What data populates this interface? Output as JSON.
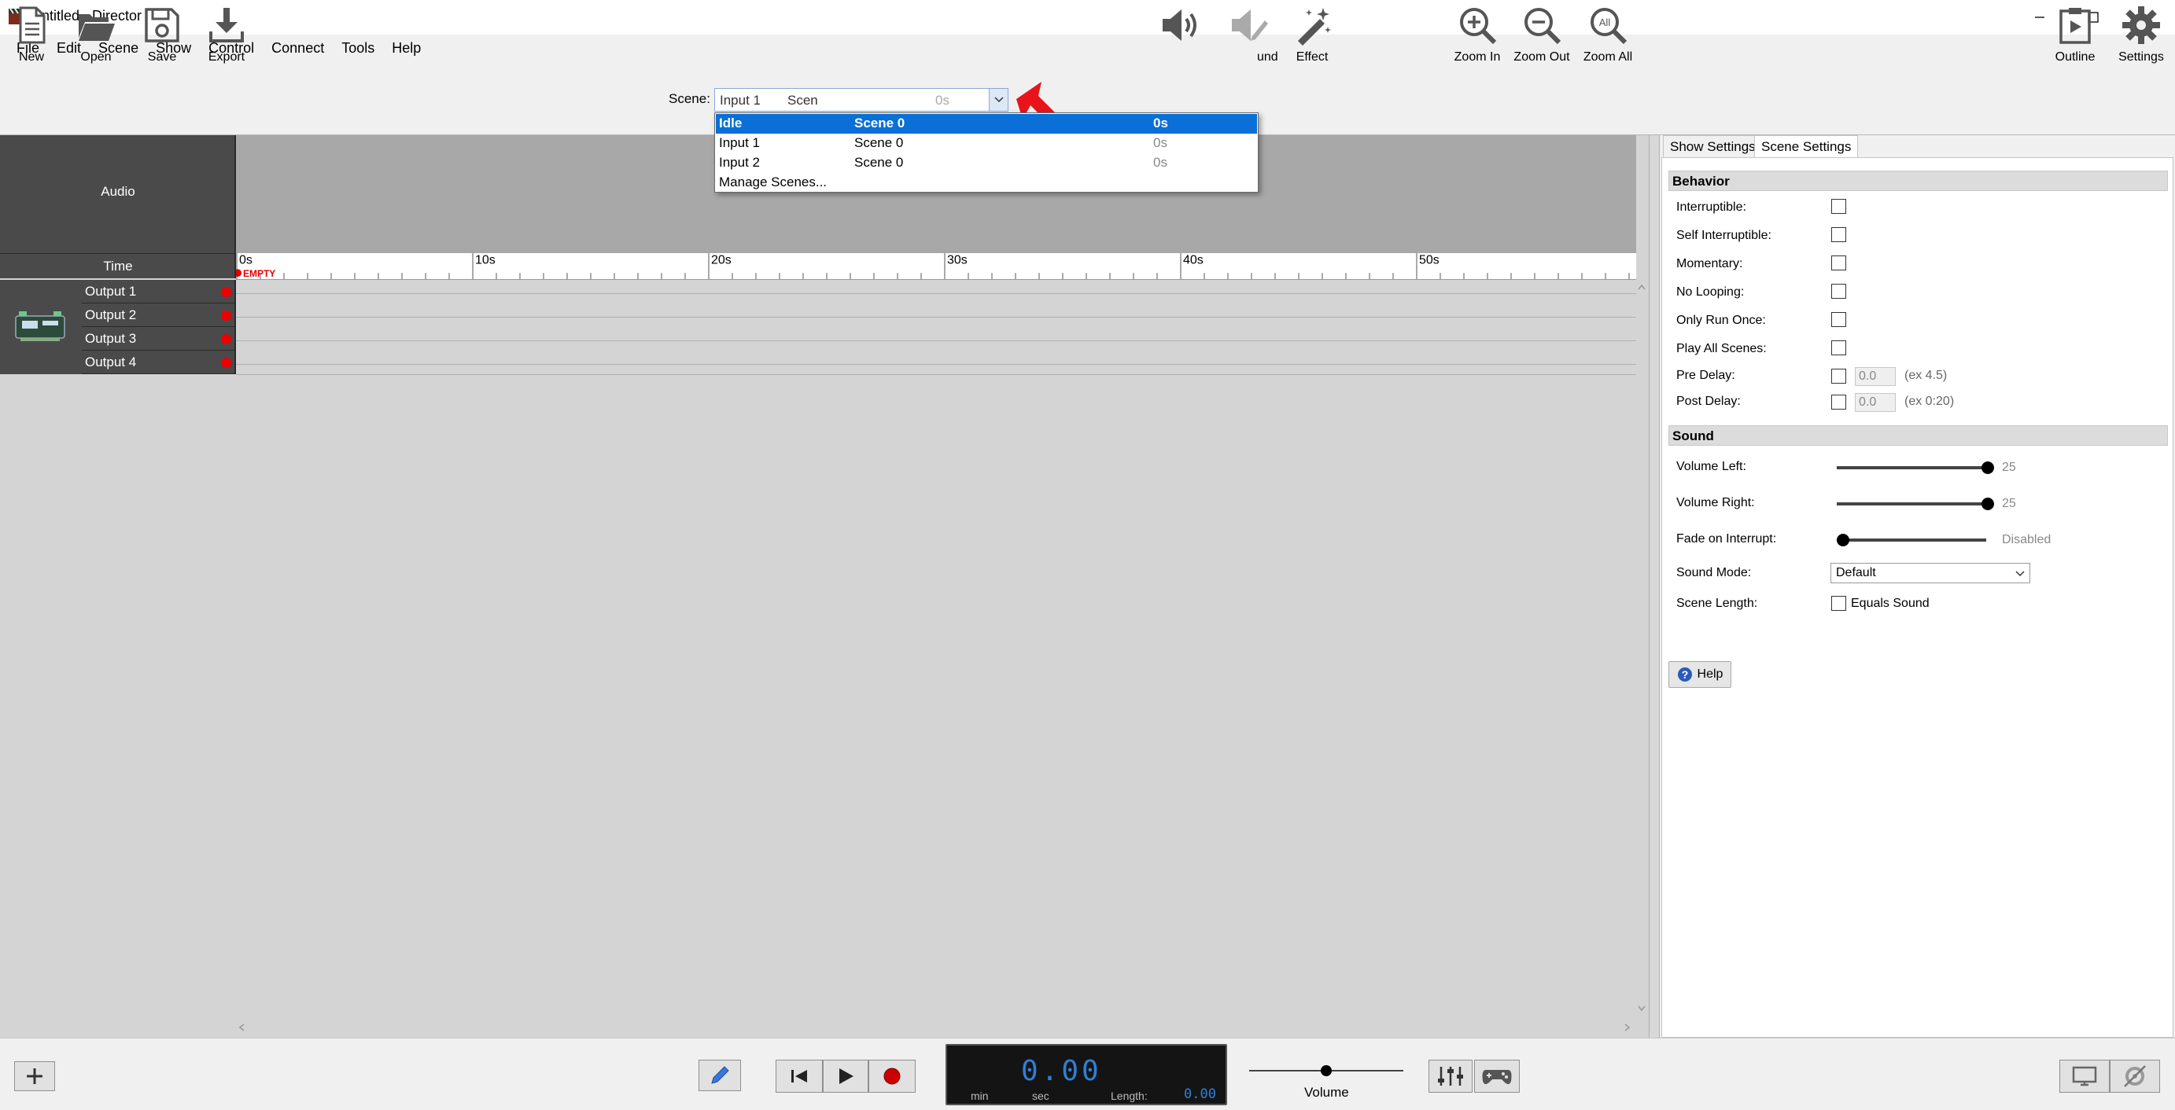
{
  "window": {
    "title": "Untitled - Director"
  },
  "menu": [
    "File",
    "Edit",
    "Scene",
    "Show",
    "Control",
    "Connect",
    "Tools",
    "Help"
  ],
  "toolbar": {
    "new": "New",
    "open": "Open",
    "save": "Save",
    "export": "Export",
    "sound": "und",
    "effect": "Effect",
    "zoom_in": "Zoom In",
    "zoom_out": "Zoom Out",
    "zoom_all": "Zoom All",
    "zoom_all_badge": "All",
    "outline": "Outline",
    "settings": "Settings"
  },
  "scene_selector": {
    "label": "Scene:",
    "current_input": "Input 1",
    "current_scene": "Scen",
    "current_time": "0s",
    "options": [
      {
        "name": "Idle",
        "scene": "Scene 0",
        "time": "0s",
        "selected": true
      },
      {
        "name": "Input 1",
        "scene": "Scene 0",
        "time": "0s",
        "selected": false
      },
      {
        "name": "Input 2",
        "scene": "Scene 0",
        "time": "0s",
        "selected": false
      }
    ],
    "manage": "Manage Scenes..."
  },
  "timeline": {
    "audio_label": "Audio",
    "time_label": "Time",
    "ruler_ticks": [
      "0s",
      "10s",
      "20s",
      "30s",
      "40s",
      "50s"
    ],
    "empty_marker": "EMPTY",
    "outputs": [
      "Output 1",
      "Output 2",
      "Output 3",
      "Output 4"
    ]
  },
  "right_panel": {
    "tabs": [
      "Show Settings",
      "Scene Settings"
    ],
    "active_tab": "Scene Settings",
    "behavior": {
      "heading": "Behavior",
      "interruptible": "Interruptible:",
      "self_interruptible": "Self Interruptible:",
      "momentary": "Momentary:",
      "no_looping": "No Looping:",
      "only_run_once": "Only Run Once:",
      "play_all_scenes": "Play All Scenes:",
      "pre_delay": "Pre Delay:",
      "pre_delay_value": "0.0",
      "pre_delay_hint": "(ex 4.5)",
      "post_delay": "Post Delay:",
      "post_delay_value": "0.0",
      "post_delay_hint": "(ex 0:20)"
    },
    "sound": {
      "heading": "Sound",
      "volume_left": "Volume Left:",
      "volume_left_value": "25",
      "volume_left_level": 1.0,
      "volume_right": "Volume Right:",
      "volume_right_value": "25",
      "volume_right_level": 1.0,
      "fade_on_interrupt": "Fade on Interrupt:",
      "fade_value": "Disabled",
      "fade_level": 0.0,
      "sound_mode": "Sound Mode:",
      "sound_mode_value": "Default",
      "scene_length": "Scene Length:",
      "equals_sound": "Equals Sound"
    },
    "help": "Help"
  },
  "transport": {
    "time_display": "0.00",
    "min_label": "min",
    "sec_label": "sec",
    "length_label": "Length:",
    "length_value": "0.00",
    "volume_label": "Volume",
    "volume_level": 0.5
  },
  "colors": {
    "accent": "#0a6fd6",
    "record": "#e00000",
    "lcd_text": "#2f7fd8"
  }
}
